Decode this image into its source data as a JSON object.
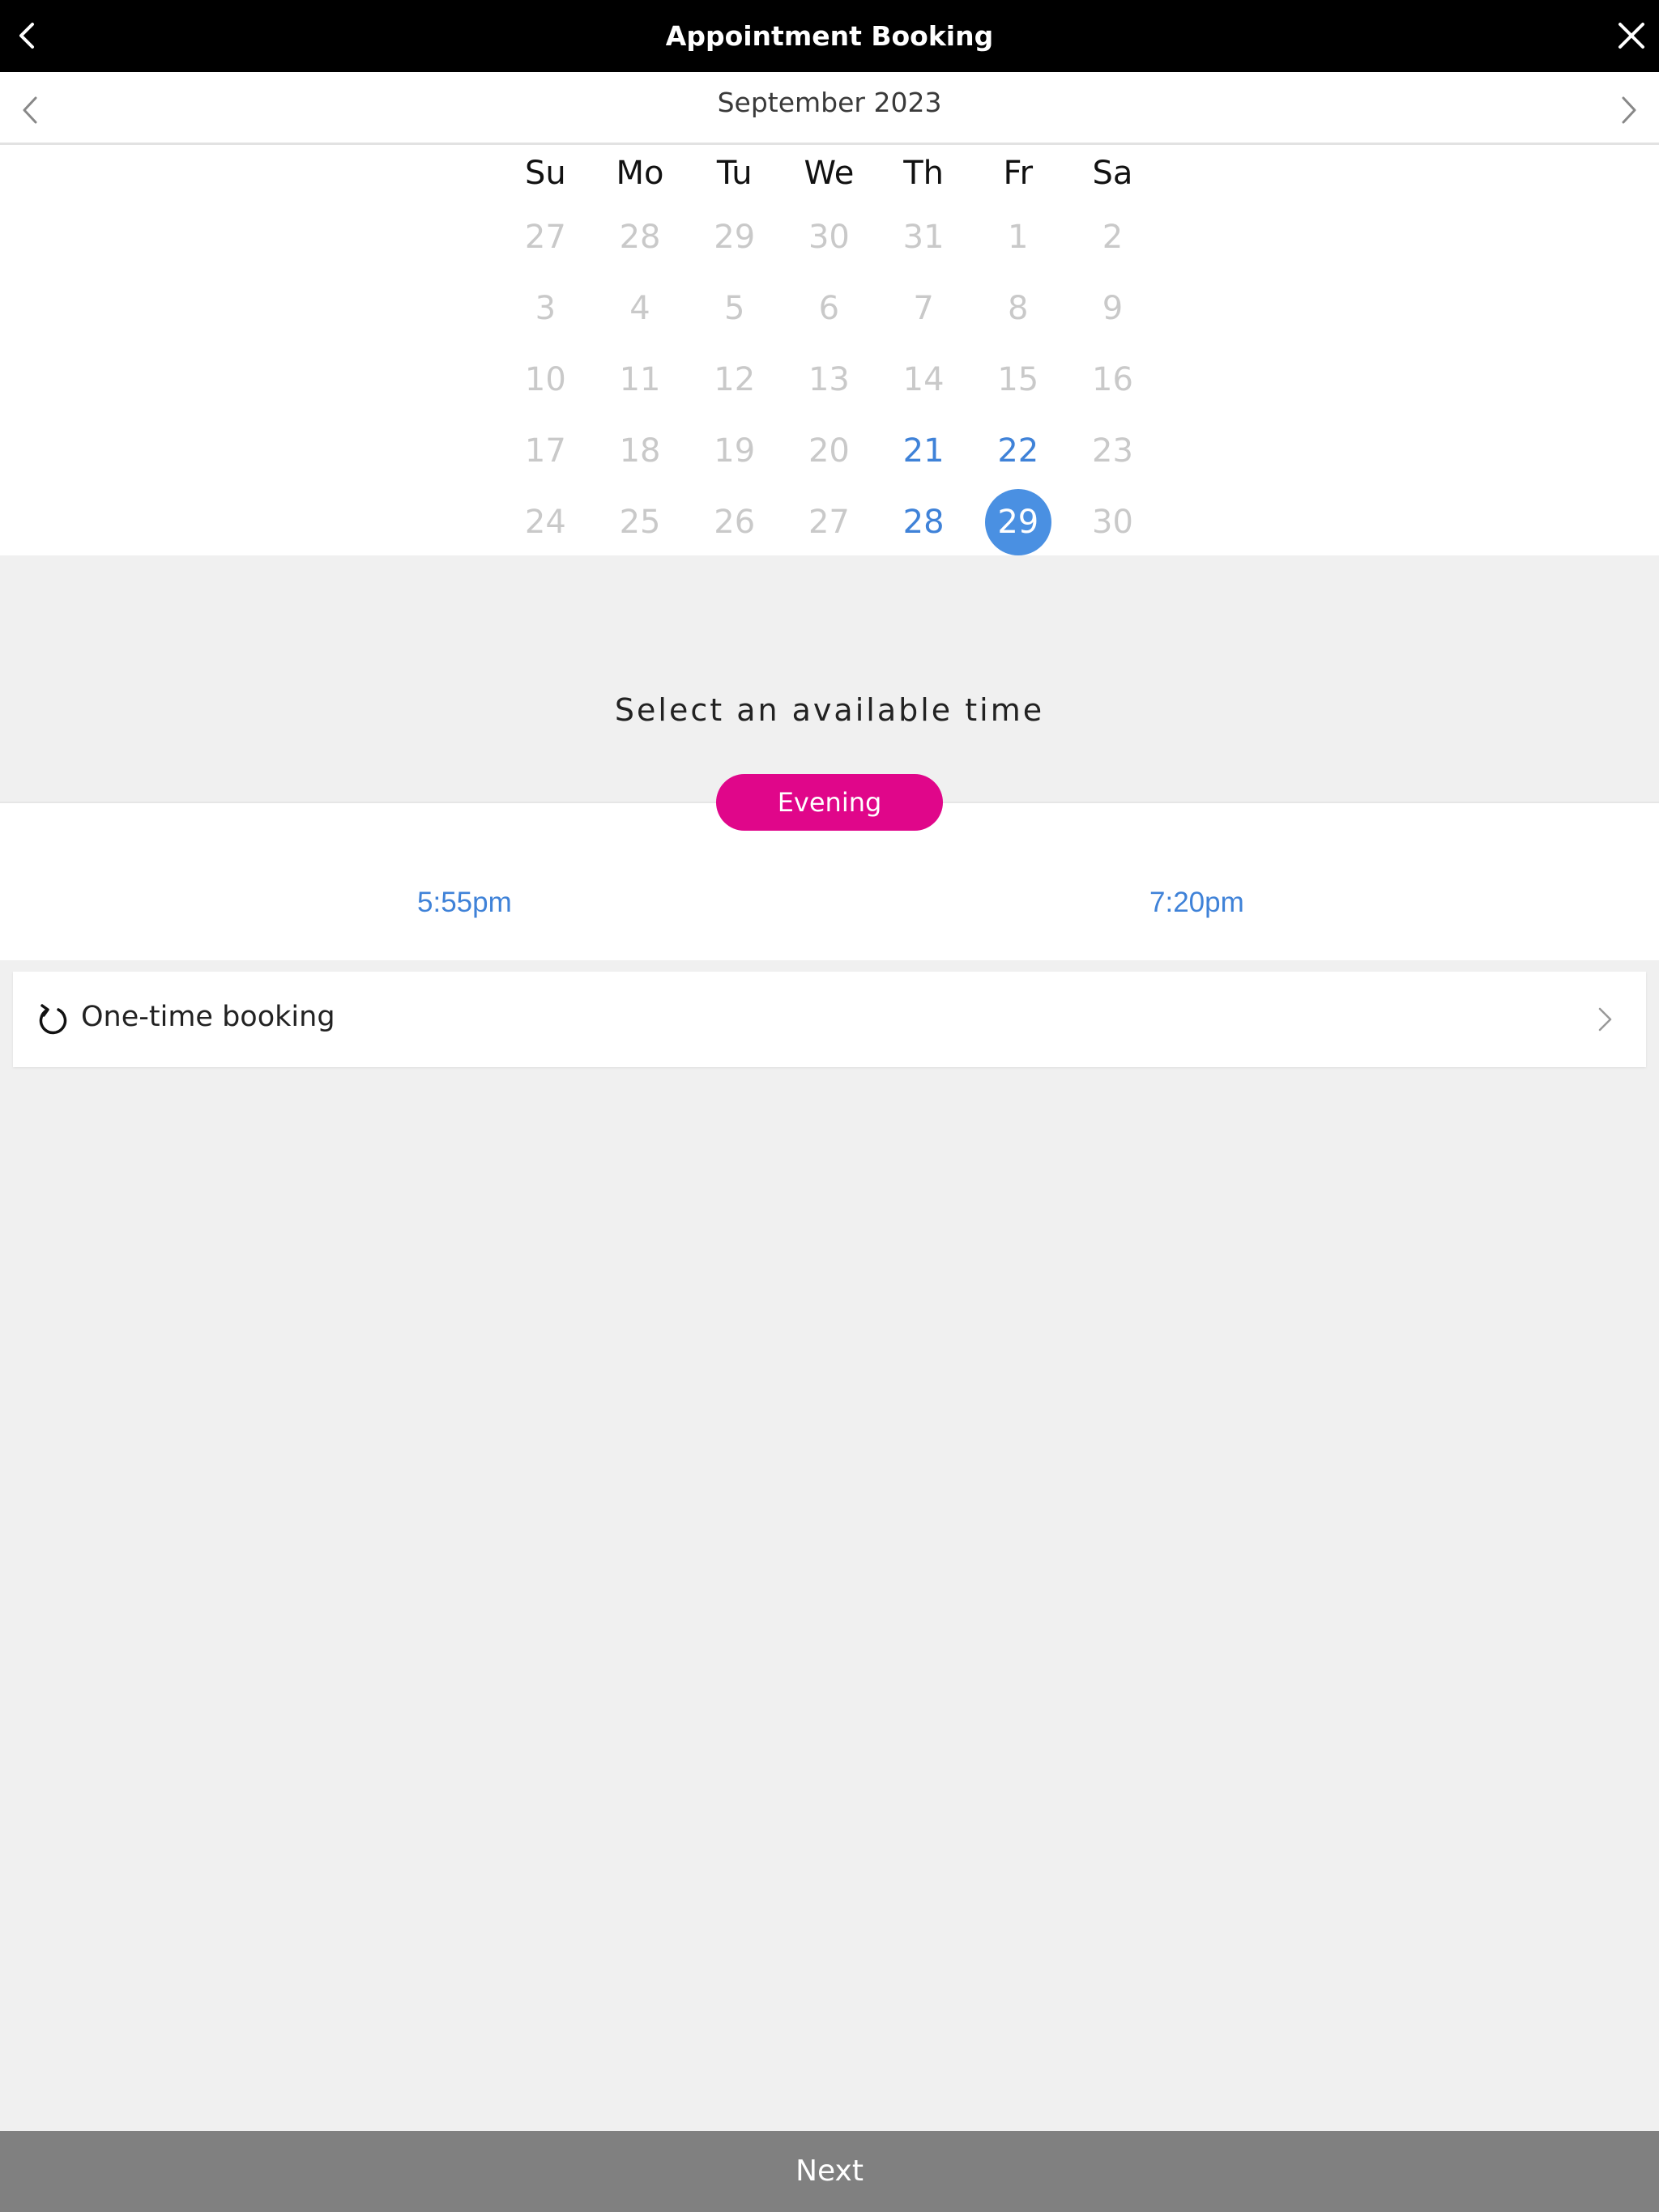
{
  "header": {
    "title": "Appointment Booking"
  },
  "calendar": {
    "month_label": "September 2023",
    "weekdays": [
      "Su",
      "Mo",
      "Tu",
      "We",
      "Th",
      "Fr",
      "Sa"
    ],
    "weeks": [
      [
        {
          "d": "27",
          "s": "out"
        },
        {
          "d": "28",
          "s": "out"
        },
        {
          "d": "29",
          "s": "out"
        },
        {
          "d": "30",
          "s": "out"
        },
        {
          "d": "31",
          "s": "out"
        },
        {
          "d": "1",
          "s": "disabled"
        },
        {
          "d": "2",
          "s": "disabled"
        }
      ],
      [
        {
          "d": "3",
          "s": "disabled"
        },
        {
          "d": "4",
          "s": "disabled"
        },
        {
          "d": "5",
          "s": "disabled"
        },
        {
          "d": "6",
          "s": "disabled"
        },
        {
          "d": "7",
          "s": "disabled"
        },
        {
          "d": "8",
          "s": "disabled"
        },
        {
          "d": "9",
          "s": "disabled"
        }
      ],
      [
        {
          "d": "10",
          "s": "disabled"
        },
        {
          "d": "11",
          "s": "disabled"
        },
        {
          "d": "12",
          "s": "disabled"
        },
        {
          "d": "13",
          "s": "disabled"
        },
        {
          "d": "14",
          "s": "disabled"
        },
        {
          "d": "15",
          "s": "disabled"
        },
        {
          "d": "16",
          "s": "disabled"
        }
      ],
      [
        {
          "d": "17",
          "s": "disabled"
        },
        {
          "d": "18",
          "s": "disabled"
        },
        {
          "d": "19",
          "s": "disabled"
        },
        {
          "d": "20",
          "s": "disabled"
        },
        {
          "d": "21",
          "s": "available"
        },
        {
          "d": "22",
          "s": "available"
        },
        {
          "d": "23",
          "s": "disabled"
        }
      ],
      [
        {
          "d": "24",
          "s": "disabled"
        },
        {
          "d": "25",
          "s": "disabled"
        },
        {
          "d": "26",
          "s": "disabled"
        },
        {
          "d": "27",
          "s": "disabled"
        },
        {
          "d": "28",
          "s": "available"
        },
        {
          "d": "29",
          "s": "selected"
        },
        {
          "d": "30",
          "s": "disabled"
        }
      ]
    ]
  },
  "times": {
    "heading": "Select an available time",
    "period": "Evening",
    "slots": [
      "5:55pm",
      "7:20pm"
    ]
  },
  "booking": {
    "label": "One-time booking",
    "icon": "refresh-icon"
  },
  "footer": {
    "next_label": "Next"
  },
  "colors": {
    "accent": "#4a90e2",
    "pill": "#e0068a",
    "disabled": "#c9c9c9",
    "footer": "#808080"
  }
}
